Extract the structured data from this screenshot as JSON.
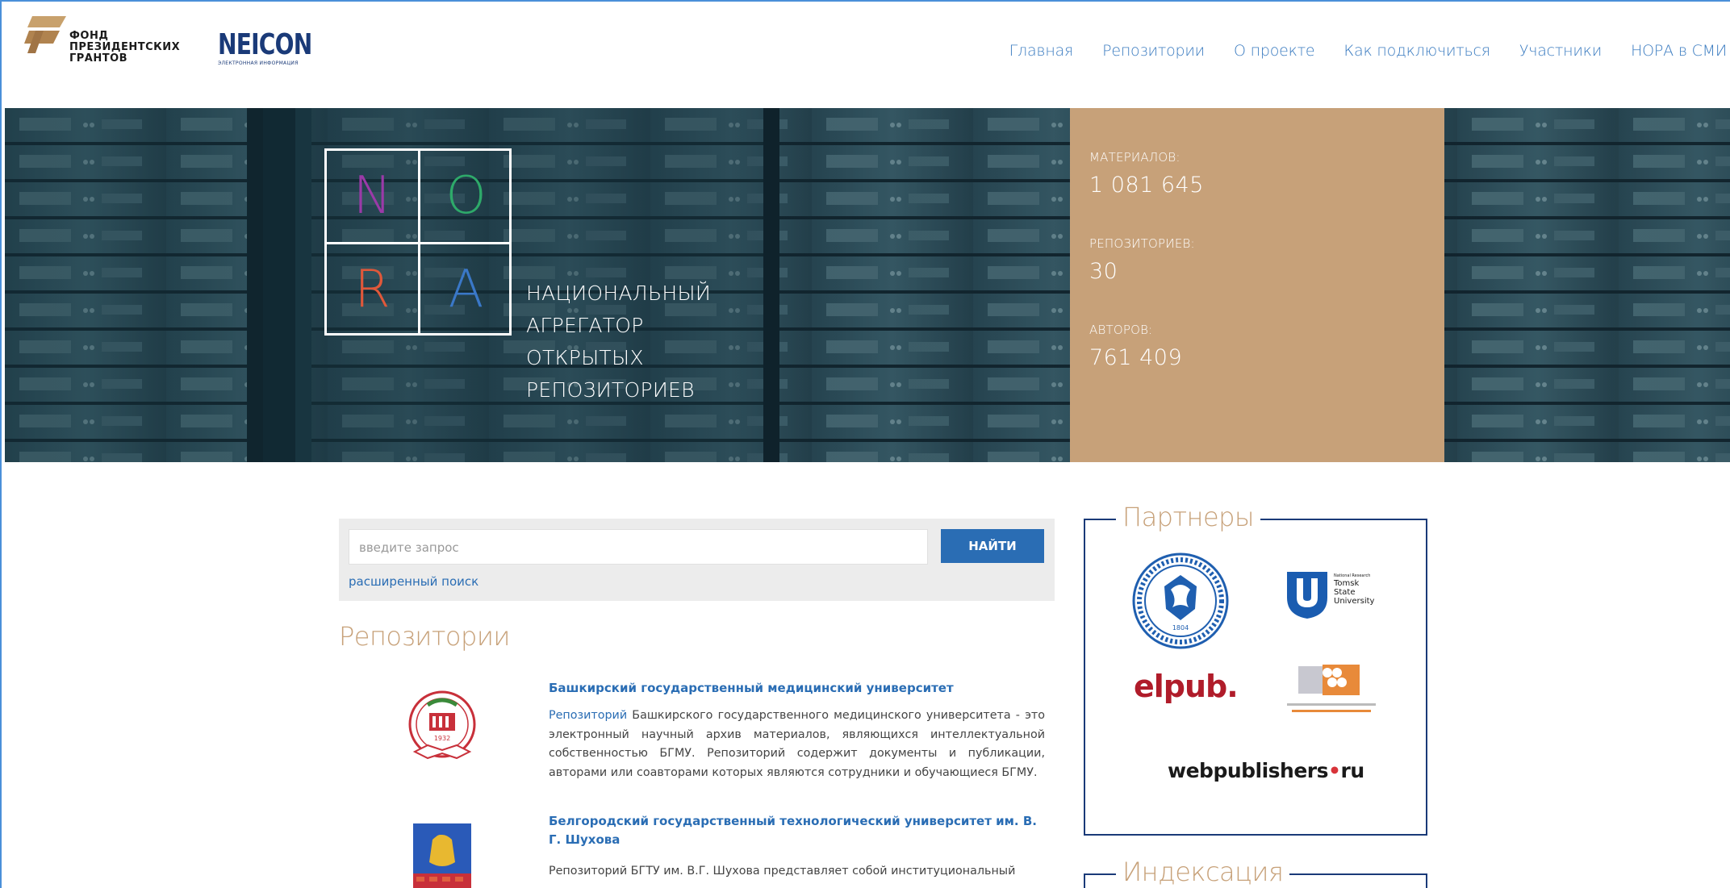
{
  "header": {
    "fpg_logo_lines": [
      "ФОНД",
      "ПРЕЗИДЕНТСКИХ",
      "ГРАНТОВ"
    ],
    "neicon_logo": "NEICON",
    "neicon_sub": "ЭЛЕКТРОННАЯ ИНФОРМАЦИЯ",
    "nav": [
      "Главная",
      "Репозитории",
      "О проекте",
      "Как подключиться",
      "Участники",
      "НОРА в СМИ"
    ]
  },
  "hero": {
    "nora_letters": [
      "N",
      "O",
      "R",
      "A"
    ],
    "nora_colors": [
      "#9b3aa8",
      "#2eaa6a",
      "#e0583a",
      "#3a78c8"
    ],
    "tagline": [
      "НАЦИОНАЛЬНЫЙ",
      "АГРЕГАТОР",
      "ОТКРЫТЫХ",
      "РЕПОЗИТОРИЕВ"
    ],
    "stats": [
      {
        "label": "МАТЕРИАЛОВ:",
        "value": "1 081 645"
      },
      {
        "label": "РЕПОЗИТОРИЕВ:",
        "value": "30"
      },
      {
        "label": "АВТОРОВ:",
        "value": "761 409"
      }
    ],
    "accent_color": "#c7a179"
  },
  "search": {
    "placeholder": "введите запрос",
    "button_label": "НАЙТИ",
    "advanced_link": "расширенный поиск"
  },
  "repositories": {
    "title": "Репозитории",
    "items": [
      {
        "name": "Башкирский государственный медицинский университет",
        "desc_link": "Репозиторий",
        "desc": " Башкирского государственного медицинского университета - это электронный научный архив материалов, являющихся интеллектуальной собственностью БГМУ. Репозиторий содержит документы и публикации, авторами или соавторами которых являются сотрудники и обучающиеся БГМУ.",
        "logo_year": "1932"
      },
      {
        "name": "Белгородский государственный технологический университет им. В. Г. Шухова",
        "desc": "Репозиторий БГТУ им. В.Г. Шухова представляет собой институциональный"
      }
    ]
  },
  "partners": {
    "title": "Партнеры",
    "kfu_year": "1804",
    "tomsk_lines": [
      "Tomsk",
      "State",
      "University"
    ],
    "tomsk_small": "National Research",
    "elpub": "elpub.",
    "webpub_a": "webpublishers",
    "webpub_dot": "•",
    "webpub_b": "ru"
  },
  "indexing": {
    "title": "Индексация"
  }
}
